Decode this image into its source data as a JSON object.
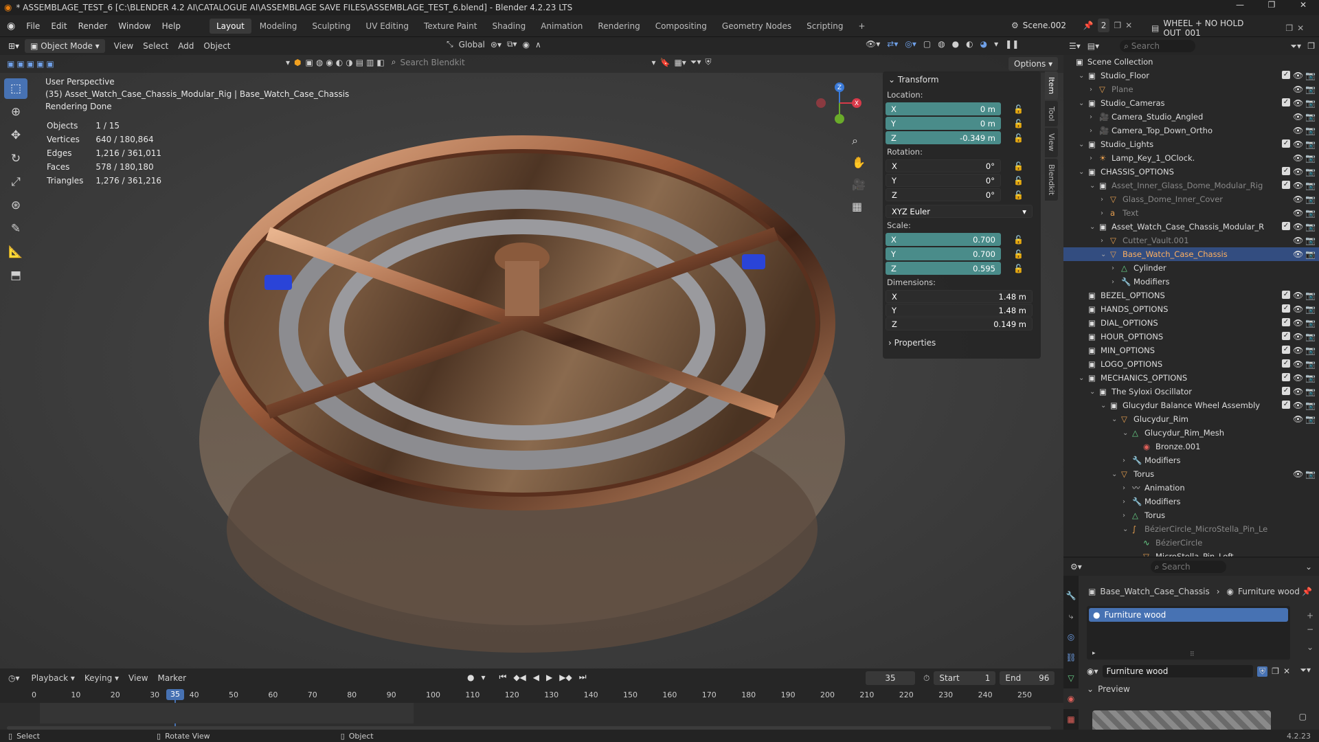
{
  "titlebar": {
    "title": "* ASSEMBLAGE_TEST_6 [C:\\BLENDER 4.2 AI\\CATALOGUE AI\\ASSEMBLAGE SAVE FILES\\ASSEMBLAGE_TEST_6.blend] - Blender 4.2.23 LTS"
  },
  "menubar": {
    "menus": [
      "File",
      "Edit",
      "Render",
      "Window",
      "Help"
    ],
    "workspaces": [
      "Layout",
      "Modeling",
      "Sculpting",
      "UV Editing",
      "Texture Paint",
      "Shading",
      "Animation",
      "Rendering",
      "Compositing",
      "Geometry Nodes",
      "Scripting"
    ],
    "active_workspace": "Layout",
    "scene": "Scene.002",
    "scene_users": "2",
    "view_layer": "WHEEL + NO HOLD OUT_001"
  },
  "viewport_header": {
    "mode": "Object Mode",
    "menus": [
      "View",
      "Select",
      "Add",
      "Object"
    ],
    "orientation": "Global",
    "search_placeholder": "Search Blendkit",
    "options": "Options"
  },
  "viewport": {
    "view_name": "User Perspective",
    "object_path": "(35) Asset_Watch_Case_Chassis_Modular_Rig | Base_Watch_Case_Chassis",
    "status": "Rendering Done",
    "stats": [
      {
        "label": "Objects",
        "value": "1 / 15"
      },
      {
        "label": "Vertices",
        "value": "640 / 180,864"
      },
      {
        "label": "Edges",
        "value": "1,216 / 361,011"
      },
      {
        "label": "Faces",
        "value": "578 / 180,180"
      },
      {
        "label": "Triangles",
        "value": "1,276 / 361,216"
      }
    ],
    "gizmo_axes": [
      "X",
      "Y",
      "Z"
    ]
  },
  "npanel": {
    "tabs": [
      "Item",
      "Tool",
      "View",
      "Blendkit"
    ],
    "transform_label": "Transform",
    "location_label": "Location:",
    "location": {
      "x": "0 m",
      "y": "0 m",
      "z": "-0.349 m"
    },
    "rotation_label": "Rotation:",
    "rotation": {
      "x": "0°",
      "y": "0°",
      "z": "0°"
    },
    "rotation_mode": "XYZ Euler",
    "scale_label": "Scale:",
    "scale": {
      "x": "0.700",
      "y": "0.700",
      "z": "0.595"
    },
    "dimensions_label": "Dimensions:",
    "dimensions": {
      "x": "1.48 m",
      "y": "1.48 m",
      "z": "0.149 m"
    },
    "properties_label": "Properties",
    "axis_labels": {
      "x": "X",
      "y": "Y",
      "z": "Z"
    }
  },
  "outliner": {
    "search_placeholder": "Search",
    "root": "Scene Collection",
    "rows": [
      {
        "name": "Studio_Floor",
        "depth": 1,
        "icon": "collection",
        "expand": "v",
        "check": true
      },
      {
        "name": "Plane",
        "depth": 2,
        "icon": "mesh",
        "expand": ">",
        "dim": true
      },
      {
        "name": "Studio_Cameras",
        "depth": 1,
        "icon": "collection",
        "expand": "v",
        "check": true
      },
      {
        "name": "Camera_Studio_Angled",
        "depth": 2,
        "icon": "camera",
        "expand": ">"
      },
      {
        "name": "Camera_Top_Down_Ortho",
        "depth": 2,
        "icon": "camera",
        "expand": ">"
      },
      {
        "name": "Studio_Lights",
        "depth": 1,
        "icon": "collection",
        "expand": "v",
        "check": true
      },
      {
        "name": "Lamp_Key_1_OClock.",
        "depth": 2,
        "icon": "light",
        "expand": ">"
      },
      {
        "name": "CHASSIS_OPTIONS",
        "depth": 1,
        "icon": "collection",
        "expand": "v",
        "check": true
      },
      {
        "name": "Asset_Inner_Glass_Dome_Modular_Rig",
        "depth": 2,
        "icon": "collection",
        "expand": "v",
        "dim": true,
        "check": true
      },
      {
        "name": "Glass_Dome_Inner_Cover",
        "depth": 3,
        "icon": "mesh",
        "expand": ">",
        "dim": true
      },
      {
        "name": "Text",
        "depth": 3,
        "icon": "text",
        "expand": ">",
        "dim": true
      },
      {
        "name": "Asset_Watch_Case_Chassis_Modular_R",
        "depth": 2,
        "icon": "collection",
        "expand": "v",
        "check": true
      },
      {
        "name": "Cutter_Vault.001",
        "depth": 3,
        "icon": "mesh",
        "expand": ">",
        "dim": true
      },
      {
        "name": "Base_Watch_Case_Chassis",
        "depth": 3,
        "icon": "mesh",
        "expand": "v",
        "selected": true
      },
      {
        "name": "Cylinder",
        "depth": 4,
        "icon": "mesh-data",
        "expand": ">"
      },
      {
        "name": "Modifiers",
        "depth": 4,
        "icon": "wrench",
        "expand": ">"
      },
      {
        "name": "BEZEL_OPTIONS",
        "depth": 1,
        "icon": "collection",
        "expand": "",
        "check": true
      },
      {
        "name": "HANDS_OPTIONS",
        "depth": 1,
        "icon": "collection",
        "expand": "",
        "check": true
      },
      {
        "name": "DIAL_OPTIONS",
        "depth": 1,
        "icon": "collection",
        "expand": "",
        "check": true
      },
      {
        "name": "HOUR_OPTIONS",
        "depth": 1,
        "icon": "collection",
        "expand": "",
        "check": true
      },
      {
        "name": "MIN_OPTIONS",
        "depth": 1,
        "icon": "collection",
        "expand": "",
        "check": true
      },
      {
        "name": "LOGO_OPTIONS",
        "depth": 1,
        "icon": "collection",
        "expand": "",
        "check": true
      },
      {
        "name": "MECHANICS_OPTIONS",
        "depth": 1,
        "icon": "collection",
        "expand": "v",
        "check": true
      },
      {
        "name": "The Syloxi Oscillator",
        "depth": 2,
        "icon": "collection",
        "expand": "v",
        "check": true
      },
      {
        "name": "Glucydur Balance Wheel Assembly",
        "depth": 3,
        "icon": "collection",
        "expand": "v",
        "check": true
      },
      {
        "name": "Glucydur_Rim",
        "depth": 4,
        "icon": "mesh",
        "expand": "v"
      },
      {
        "name": "Glucydur_Rim_Mesh",
        "depth": 5,
        "icon": "mesh-data",
        "expand": "v"
      },
      {
        "name": "Bronze.001",
        "depth": 6,
        "icon": "material",
        "expand": ""
      },
      {
        "name": "Modifiers",
        "depth": 5,
        "icon": "wrench",
        "expand": ">"
      },
      {
        "name": "Torus",
        "depth": 4,
        "icon": "mesh",
        "expand": "v"
      },
      {
        "name": "Animation",
        "depth": 5,
        "icon": "anim",
        "expand": ">"
      },
      {
        "name": "Modifiers",
        "depth": 5,
        "icon": "wrench",
        "expand": ">"
      },
      {
        "name": "Torus",
        "depth": 5,
        "icon": "mesh-data",
        "expand": ">"
      },
      {
        "name": "BézierCircle_MicroStella_Pin_Le",
        "depth": 5,
        "icon": "curve",
        "expand": "v",
        "dim": true
      },
      {
        "name": "BézierCircle",
        "depth": 6,
        "icon": "curve-data",
        "expand": "",
        "dim": true
      },
      {
        "name": "MicroStella_Pin_Left",
        "depth": 6,
        "icon": "mesh",
        "expand": "v"
      }
    ]
  },
  "properties": {
    "search_placeholder": "Search",
    "breadcrumb_object": "Base_Watch_Case_Chassis",
    "breadcrumb_material": "Furniture wood",
    "slot": "Furniture wood",
    "material_name": "Furniture wood",
    "preview_label": "Preview"
  },
  "timeline": {
    "menus": [
      "Playback",
      "Keying",
      "View",
      "Marker"
    ],
    "current_frame": "35",
    "start_label": "Start",
    "start": "1",
    "end_label": "End",
    "end": "96",
    "ticks": [
      "0",
      "10",
      "20",
      "30",
      "40",
      "50",
      "60",
      "70",
      "80",
      "90",
      "100",
      "110",
      "120",
      "130",
      "140",
      "150",
      "160",
      "170",
      "180",
      "190",
      "200",
      "210",
      "220",
      "230",
      "240",
      "250"
    ]
  },
  "statusbar": {
    "hints": [
      "Select",
      "Rotate View",
      "Object"
    ],
    "version": "4.2.23"
  }
}
